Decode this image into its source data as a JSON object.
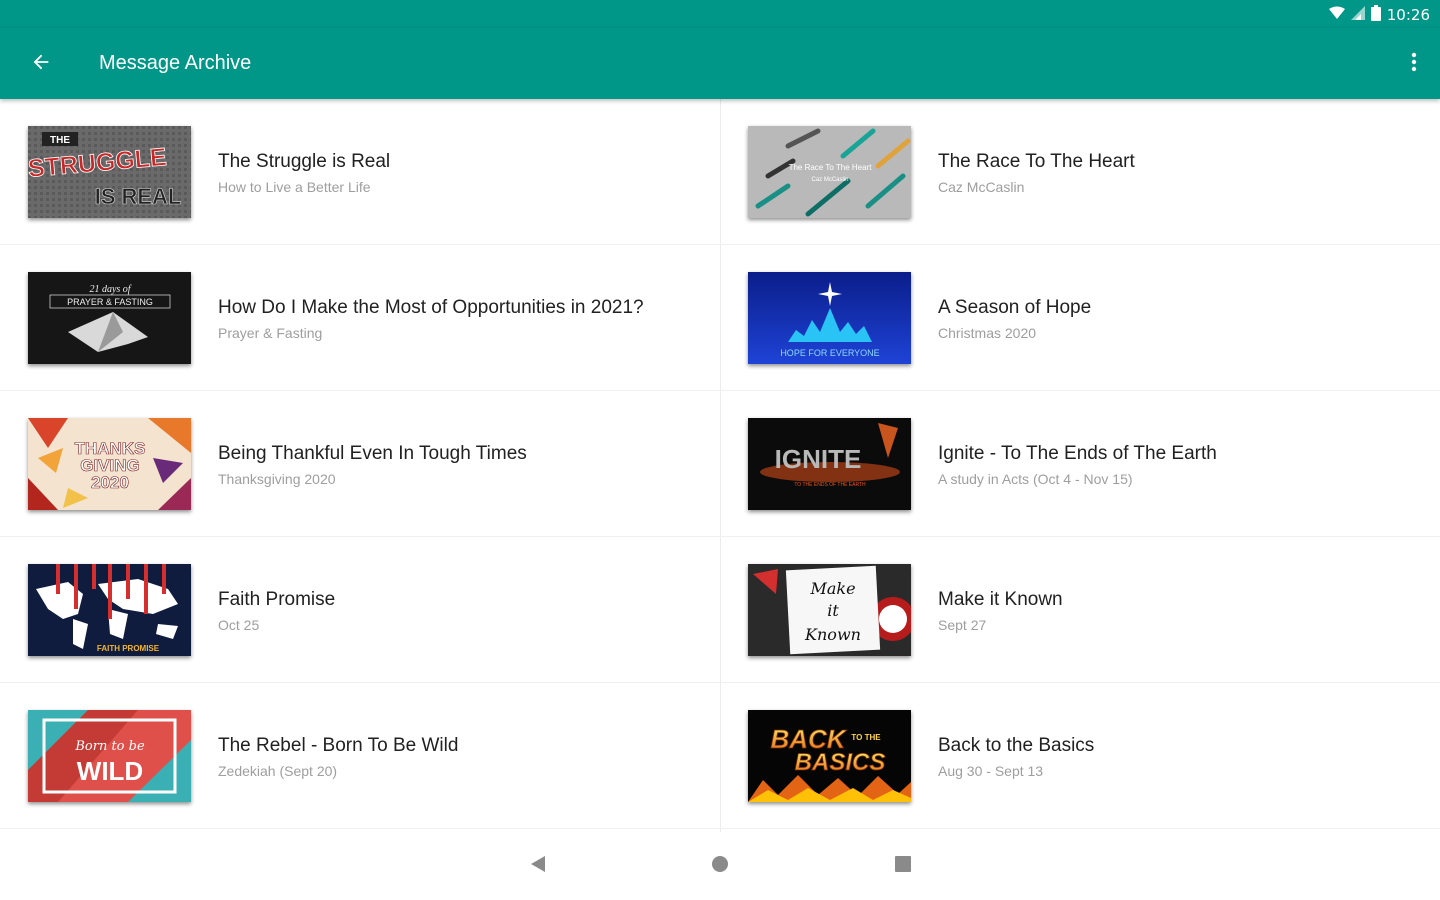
{
  "status": {
    "time": "10:26"
  },
  "appbar": {
    "title": "Message Archive",
    "back_icon": "arrow-back-icon",
    "more_icon": "more-vert-icon"
  },
  "colors": {
    "primary": "#009688",
    "title_text": "#212121",
    "subtitle_text": "#9e9e9e"
  },
  "items": [
    {
      "title": "The Struggle is Real",
      "subtitle": "How to Live a Better Life",
      "thumb_text": [
        "THE",
        "STRUGGLE",
        "IS REAL"
      ]
    },
    {
      "title": "The Race To The Heart",
      "subtitle": "Caz McCaslin",
      "thumb_text": [
        "The Race To The Heart",
        "Caz McCaslin"
      ]
    },
    {
      "title": "How Do I Make the Most of Opportunities in 2021?",
      "subtitle": "Prayer & Fasting",
      "thumb_text": [
        "21 days of",
        "PRAYER & FASTING"
      ]
    },
    {
      "title": "A Season of Hope",
      "subtitle": "Christmas 2020",
      "thumb_text": [
        "HOPE FOR EVERYONE"
      ]
    },
    {
      "title": "Being Thankful Even In Tough Times",
      "subtitle": "Thanksgiving 2020",
      "thumb_text": [
        "THANKS",
        "GIVING",
        "2020"
      ]
    },
    {
      "title": "Ignite - To The Ends of The Earth",
      "subtitle": "A study in Acts (Oct 4 - Nov 15)",
      "thumb_text": [
        "IGNITE",
        "TO THE ENDS OF THE EARTH"
      ]
    },
    {
      "title": "Faith Promise",
      "subtitle": "Oct 25",
      "thumb_text": [
        "FAITH PROMISE"
      ]
    },
    {
      "title": "Make it Known",
      "subtitle": "Sept 27",
      "thumb_text": [
        "Make",
        "it",
        "Known"
      ]
    },
    {
      "title": "The Rebel - Born To Be Wild",
      "subtitle": "Zedekiah (Sept 20)",
      "thumb_text": [
        "Born to be",
        "WILD"
      ]
    },
    {
      "title": "Back to the Basics",
      "subtitle": "Aug 30 - Sept 13",
      "thumb_text": [
        "BACK",
        "TO THE",
        "BASICS"
      ]
    }
  ],
  "navbar": {
    "back_icon": "nav-back-icon",
    "home_icon": "nav-home-icon",
    "recents_icon": "nav-recents-icon"
  }
}
